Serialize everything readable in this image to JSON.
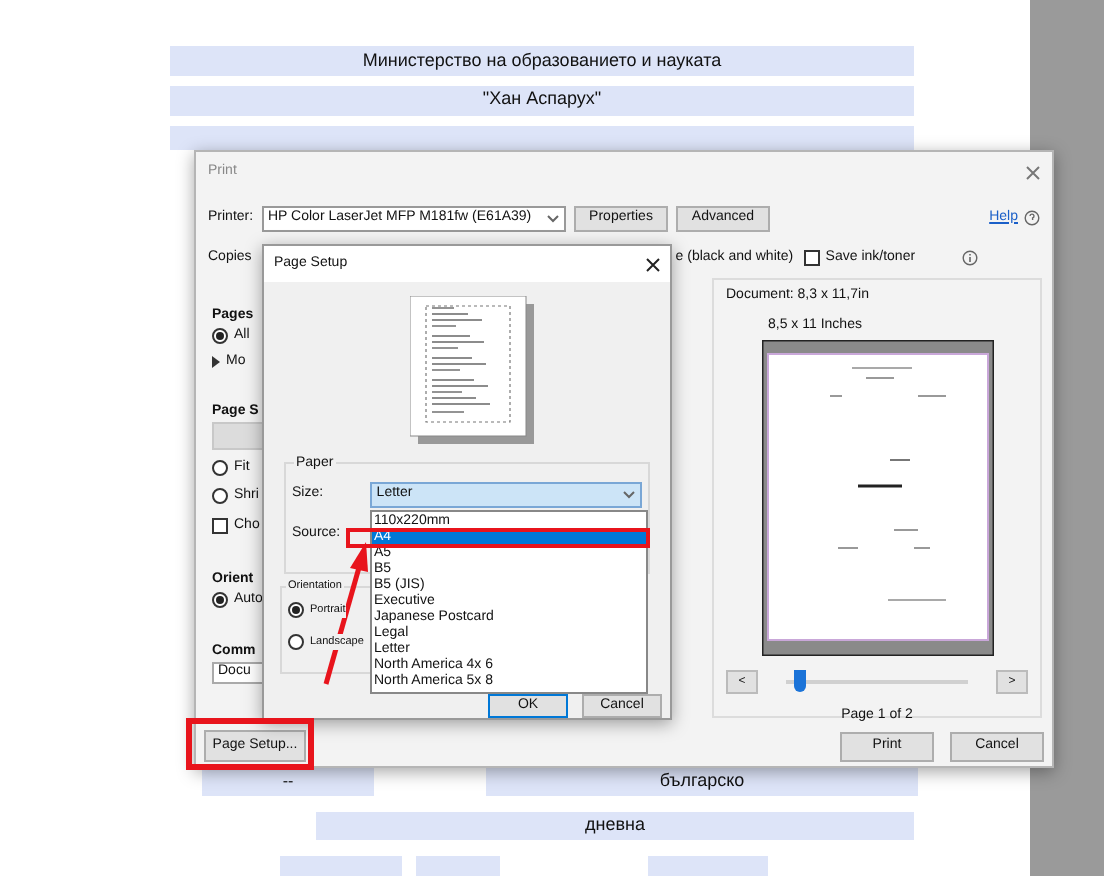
{
  "form": {
    "top_bands": [
      "Министерство на образованието и науката",
      "\"Хан Аспарух\""
    ],
    "bottom_rows": [
      [
        "--",
        "българско"
      ],
      [
        "дневна"
      ]
    ]
  },
  "print_dialog": {
    "title": "Print",
    "printer_label": "Printer:",
    "printer": "HP Color LaserJet MFP M181fw (E61A39)",
    "buttons": [
      "Properties",
      "Advanced"
    ],
    "help": "Help",
    "copies_label": "Copies",
    "grayscale_label": "e (black and white)",
    "save_ink": {
      "label": "Save ink/toner",
      "checked": false
    },
    "left_panel": [
      {
        "kind": "heading",
        "label": "Pages"
      },
      {
        "kind": "radio",
        "label": "All",
        "selected": true
      },
      {
        "kind": "expander",
        "label": "Mo"
      },
      {
        "kind": "heading",
        "label": "Page S"
      },
      {
        "kind": "button"
      },
      {
        "kind": "radio",
        "label": "Fit",
        "selected": false
      },
      {
        "kind": "radio",
        "label": "Shri",
        "selected": false
      },
      {
        "kind": "checkbox",
        "label": "Cho",
        "checked": false
      },
      {
        "kind": "heading",
        "label": "Orient"
      },
      {
        "kind": "radio",
        "label": "Auto",
        "selected": true
      },
      {
        "kind": "heading",
        "label": "Comm"
      },
      {
        "kind": "field",
        "value": "Docu"
      }
    ],
    "preview": {
      "document": "Document: 8,3 x 11,7in",
      "paper": "8,5 x 11 Inches",
      "prev": "<",
      "next": ">",
      "page_slider": {
        "level": 0.04
      },
      "page_label": "Page 1 of 2"
    },
    "page_setup_button": "Page Setup...",
    "actions": [
      "Print",
      "Cancel"
    ]
  },
  "page_setup": {
    "title": "Page Setup",
    "paper_group": "Paper",
    "size_label": "Size:",
    "size_value": "Letter",
    "source_label": "Source:",
    "size_options": [
      {
        "label": "110x220mm",
        "selected": false
      },
      {
        "label": "A4",
        "selected": true
      },
      {
        "label": "A5",
        "selected": false
      },
      {
        "label": "B5",
        "selected": false
      },
      {
        "label": "B5 (JIS)",
        "selected": false
      },
      {
        "label": "Executive",
        "selected": false
      },
      {
        "label": "Japanese Postcard",
        "selected": false
      },
      {
        "label": "Legal",
        "selected": false
      },
      {
        "label": "Letter",
        "selected": false
      },
      {
        "label": "North America 4x 6",
        "selected": false
      },
      {
        "label": "North America 5x 8",
        "selected": false
      }
    ],
    "orientation_group": "Orientation",
    "orientations": [
      {
        "label": "Portrait",
        "selected": true
      },
      {
        "label": "Landscape",
        "selected": false
      }
    ],
    "buttons": [
      "OK",
      "Cancel"
    ]
  }
}
